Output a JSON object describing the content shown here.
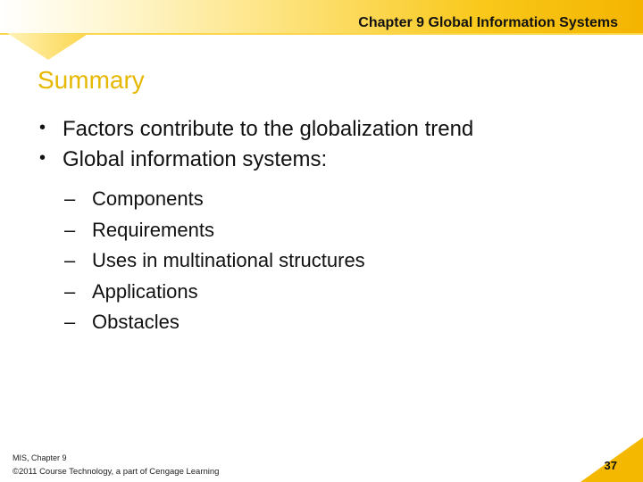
{
  "header": {
    "title": "Chapter 9 Global Information Systems"
  },
  "slide": {
    "title": "Summary",
    "bullets": [
      "Factors contribute to the globalization trend",
      "Global information systems:"
    ],
    "sub_bullets": [
      "Components",
      "Requirements",
      "Uses in multinational structures",
      "Applications",
      "Obstacles"
    ],
    "bullet_marker": "•",
    "sub_bullet_marker": "–"
  },
  "footer": {
    "chapter": "MIS, Chapter 9",
    "copyright": "©2011 Course Technology, a part of Cengage Learning",
    "page_number": "37"
  },
  "colors": {
    "title": "#e6b800",
    "accent": "#f5b800",
    "text": "#111111"
  }
}
